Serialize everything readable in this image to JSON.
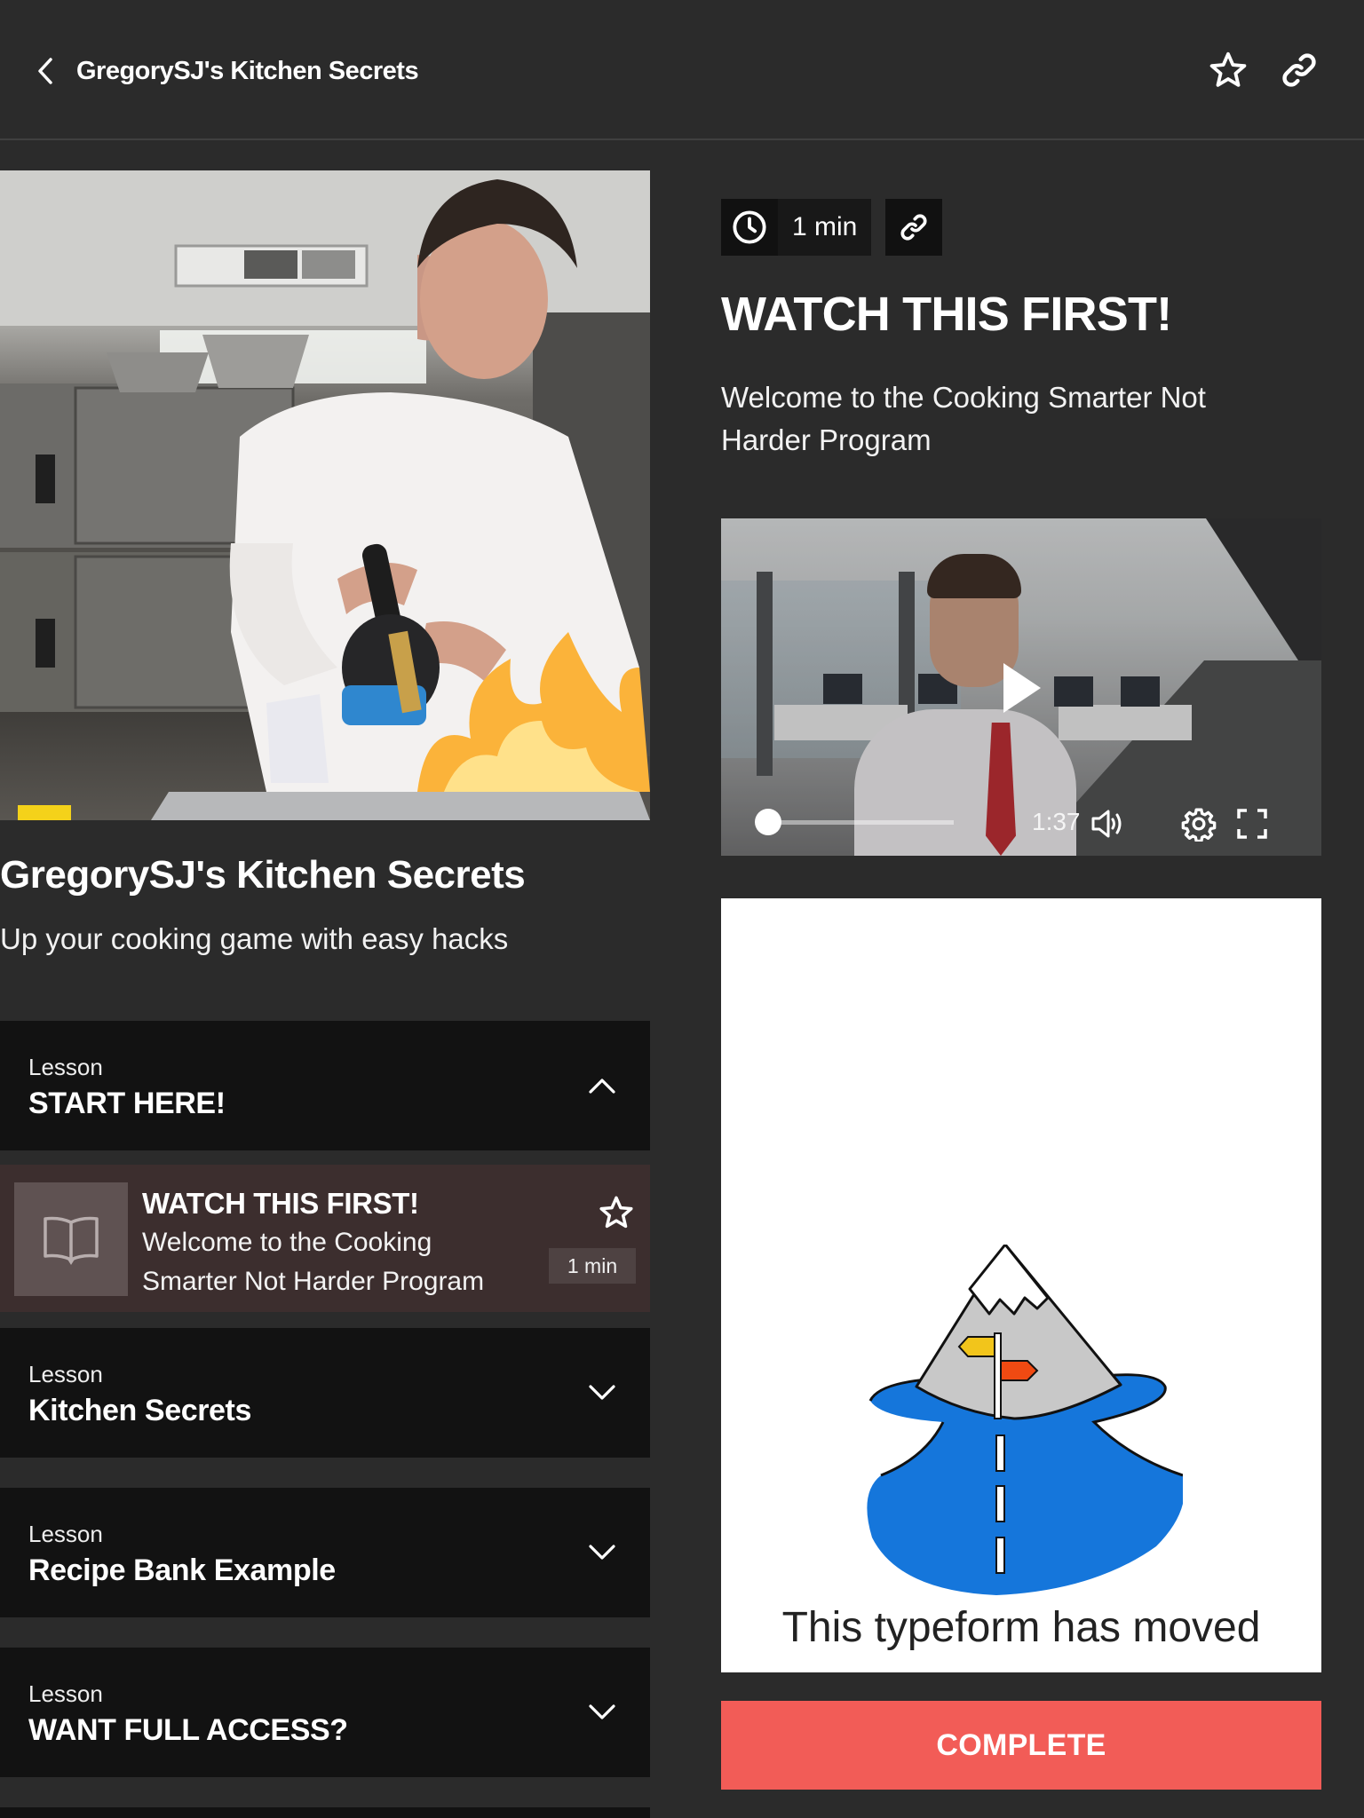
{
  "topbar": {
    "title": "GregorySJ's Kitchen Secrets",
    "icons": [
      "back-chevron-icon",
      "star-icon",
      "link-icon"
    ]
  },
  "course": {
    "title": "GregorySJ's Kitchen Secrets",
    "subtitle": "Up your cooking game with easy hacks",
    "image_alt": "Chef using a blow torch over a tray with flames in a professional kitchen"
  },
  "lessons": [
    {
      "kicker": "Lesson",
      "name": "START HERE!",
      "expanded": true,
      "items": [
        {
          "title": "WATCH THIS FIRST!",
          "description": "Welcome to the Cooking Smarter Not Harder Program",
          "duration": "1 min",
          "icon": "book-icon",
          "active": true
        }
      ]
    },
    {
      "kicker": "Lesson",
      "name": "Kitchen Secrets",
      "expanded": false
    },
    {
      "kicker": "Lesson",
      "name": "Recipe Bank Example",
      "expanded": false
    },
    {
      "kicker": "Lesson",
      "name": "WANT FULL ACCESS?",
      "expanded": false
    }
  ],
  "content": {
    "duration": "1 min",
    "title": "WATCH THIS FIRST!",
    "description": "Welcome to the Cooking Smarter Not Harder Program",
    "video": {
      "time": "1:37",
      "progress": 0,
      "controls": [
        "play-icon",
        "volume-icon",
        "settings-gear-icon",
        "fullscreen-icon"
      ]
    },
    "embed": {
      "message": "This typeform has moved"
    },
    "complete_label": "COMPLETE"
  },
  "colors": {
    "background": "#2b2b2b",
    "lesson_header": "#121212",
    "active_item": "#3c2e2e",
    "complete_button": "#f25c57",
    "illustration_blue": "#1576db",
    "sign_yellow": "#f2c51b",
    "sign_orange": "#f04a12"
  }
}
